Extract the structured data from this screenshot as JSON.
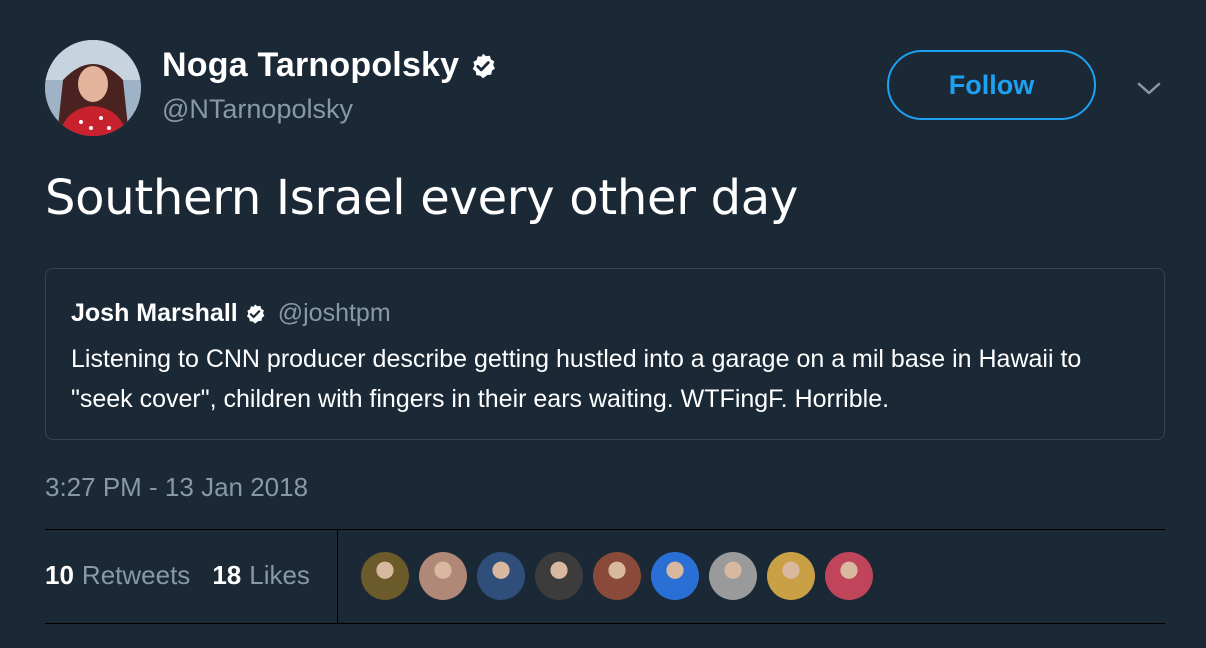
{
  "author": {
    "name": "Noga Tarnopolsky",
    "handle": "@NTarnopolsky",
    "verified": true,
    "avatar_icon": "user-avatar"
  },
  "follow_label": "Follow",
  "tweet": {
    "text": "Southern Israel every other day"
  },
  "quoted": {
    "name": "Josh Marshall",
    "handle": "@joshtpm",
    "verified": true,
    "text": "Listening to CNN producer describe getting hustled into a garage on a mil base in Hawaii to \"seek cover\", children with fingers in their ears waiting. WTFingF. Horrible."
  },
  "timestamp": "3:27 PM - 13 Jan 2018",
  "stats": {
    "retweets_count": "10",
    "retweets_label": "Retweets",
    "likes_count": "18",
    "likes_label": "Likes"
  },
  "likers": [
    {
      "icon": "liker-avatar-1",
      "color": "#6b5a2a"
    },
    {
      "icon": "liker-avatar-2",
      "color": "#b08878"
    },
    {
      "icon": "liker-avatar-3",
      "color": "#2f4f7a"
    },
    {
      "icon": "liker-avatar-4",
      "color": "#3c3c3c"
    },
    {
      "icon": "liker-avatar-5",
      "color": "#8a4a3a"
    },
    {
      "icon": "liker-avatar-6",
      "color": "#2a6fd6"
    },
    {
      "icon": "liker-avatar-7",
      "color": "#9a9a9a"
    },
    {
      "icon": "liker-avatar-8",
      "color": "#c9a045"
    },
    {
      "icon": "liker-avatar-9",
      "color": "#c0445a"
    }
  ],
  "colors": {
    "background": "#1b2836",
    "accent": "#1da1f2",
    "muted": "#8899a6",
    "border": "#38444d"
  }
}
